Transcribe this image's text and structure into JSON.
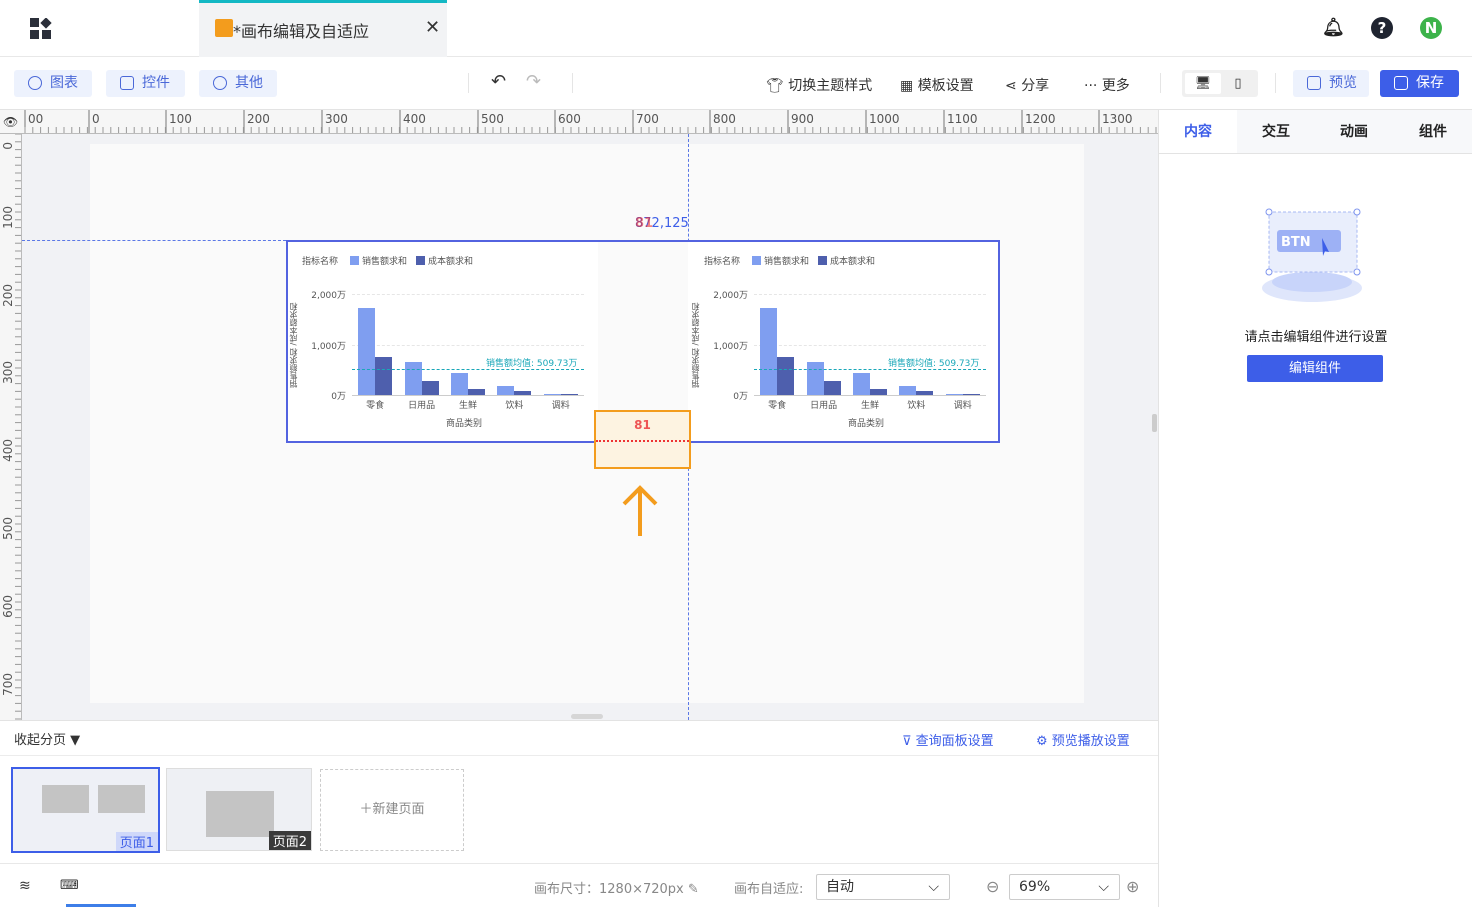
{
  "tab": {
    "title": "*画布编辑及自适应"
  },
  "toolbar": {
    "chart": "图表",
    "widget": "控件",
    "other": "其他",
    "theme": "切换主题样式",
    "template": "模板设置",
    "share": "分享",
    "more": "更多",
    "preview": "预览",
    "save": "保存"
  },
  "ruler": {
    "top": [
      "00",
      "0",
      "100",
      "200",
      "300",
      "400",
      "500",
      "600",
      "700",
      "800",
      "900",
      "1000",
      "1100",
      "1200",
      "1300"
    ],
    "left": [
      "0",
      "100",
      "200",
      "300",
      "400",
      "500",
      "600",
      "700"
    ]
  },
  "canvas": {
    "coord_label": "872,125",
    "coord_overlap": "81",
    "gap_label": "81"
  },
  "charts": [
    {
      "legend_title": "指标名称",
      "legend": [
        "销售额求和",
        "成本额求和"
      ],
      "y_ticks": [
        "2,000万",
        "1,000万",
        "0万"
      ],
      "ylabel": "销售额求和 /成本额求和",
      "xlabel": "商品类别",
      "avg_label": "销售额均值: 509.73万",
      "chart_data": {
        "type": "bar",
        "categories": [
          "零食",
          "日用品",
          "生鲜",
          "饮料",
          "调料"
        ],
        "series": [
          {
            "name": "销售额求和",
            "values": [
              1720,
              650,
              430,
              170,
              20
            ]
          },
          {
            "name": "成本额求和",
            "values": [
              750,
              280,
              120,
              80,
              10
            ]
          }
        ],
        "ylim": [
          0,
          2200
        ],
        "reference_line": 509.73
      }
    },
    {
      "legend_title": "指标名称",
      "legend": [
        "销售额求和",
        "成本额求和"
      ],
      "y_ticks": [
        "2,000万",
        "1,000万",
        "0万"
      ],
      "ylabel": "销售额求和 /成本额求和",
      "xlabel": "商品类别",
      "avg_label": "销售额均值: 509.73万",
      "chart_data": {
        "type": "bar",
        "categories": [
          "零食",
          "日用品",
          "生鲜",
          "饮料",
          "调料"
        ],
        "series": [
          {
            "name": "销售额求和",
            "values": [
              1720,
              650,
              430,
              170,
              20
            ]
          },
          {
            "name": "成本额求和",
            "values": [
              750,
              280,
              120,
              80,
              10
            ]
          }
        ],
        "ylim": [
          0,
          2200
        ],
        "reference_line": 509.73
      }
    }
  ],
  "right_panel": {
    "tabs": [
      "内容",
      "交互",
      "动画",
      "组件"
    ],
    "illustration_text": "BTN",
    "hint": "请点击编辑组件进行设置",
    "edit_button": "编辑组件"
  },
  "pages": {
    "collapse": "收起分页",
    "query_settings": "查询面板设置",
    "play_settings": "预览播放设置",
    "items": [
      "页面1",
      "页面2"
    ],
    "new_page": "新建页面"
  },
  "status": {
    "canvas_size": "画布尺寸：1280×720px",
    "adapt_label": "画布自适应:",
    "adapt_value": "自动",
    "zoom": "69%"
  },
  "colors": {
    "accent": "#3d5ee8",
    "bar1": "#7f9ef0",
    "bar2": "#4e5fad",
    "orange": "#f39c1d"
  }
}
